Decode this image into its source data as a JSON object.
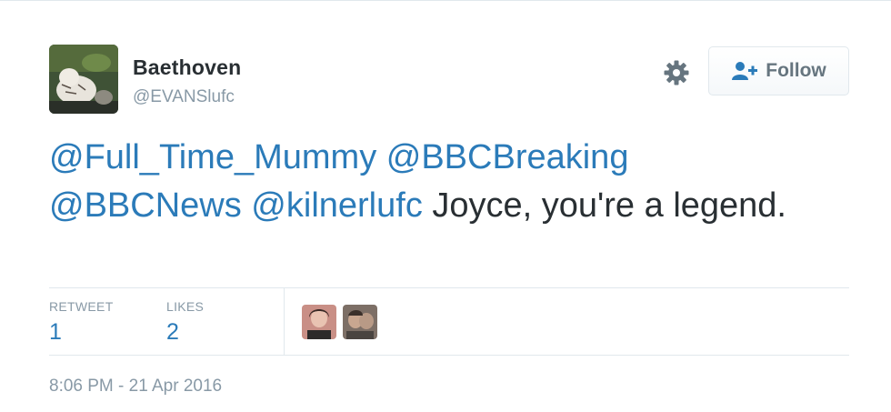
{
  "user": {
    "display_name": "Baethoven",
    "screen_name": "@EVANSlufc",
    "avatar_icon": "white-tiger-avatar"
  },
  "actions": {
    "settings_icon": "gear-icon",
    "follow_label": "Follow",
    "follow_icon": "add-user-icon"
  },
  "tweet": {
    "mentions": [
      "@Full_Time_Mummy",
      "@BBCBreaking",
      "@BBCNews",
      "@kilnerlufc"
    ],
    "text": "Joyce, you're a legend."
  },
  "stats": {
    "retweet_label": "RETWEET",
    "retweet_count": "1",
    "likes_label": "LIKES",
    "likes_count": "2"
  },
  "likers": [
    "liker-avatar-1",
    "liker-avatar-2"
  ],
  "timestamp": "8:06 PM - 21 Apr 2016",
  "colors": {
    "link": "#2b7bb9",
    "muted": "#8899a6",
    "text": "#292f33",
    "border": "#e1e8ed"
  }
}
